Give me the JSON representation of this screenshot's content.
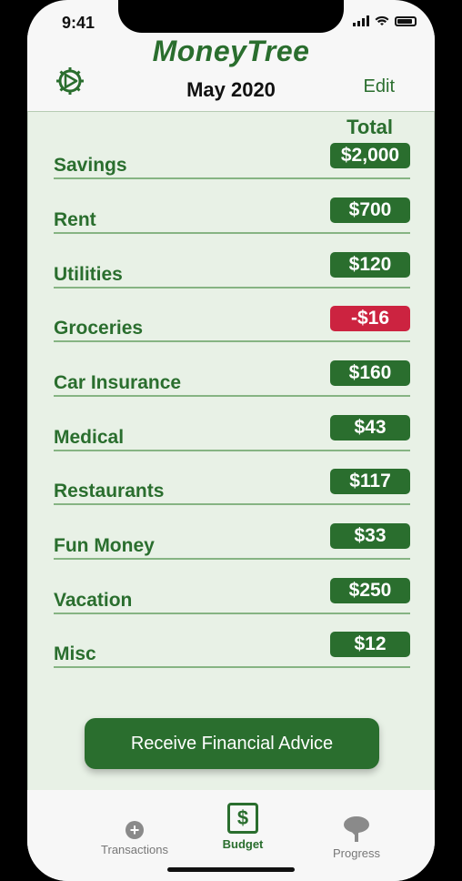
{
  "status": {
    "time": "9:41"
  },
  "header": {
    "app_title": "MoneyTree",
    "month": "May 2020",
    "edit_label": "Edit"
  },
  "table": {
    "total_header": "Total",
    "rows": [
      {
        "label": "Savings",
        "amount": "$2,000",
        "status": "positive"
      },
      {
        "label": "Rent",
        "amount": "$700",
        "status": "positive"
      },
      {
        "label": "Utilities",
        "amount": "$120",
        "status": "positive"
      },
      {
        "label": "Groceries",
        "amount": "-$16",
        "status": "negative"
      },
      {
        "label": "Car Insurance",
        "amount": "$160",
        "status": "positive"
      },
      {
        "label": "Medical",
        "amount": "$43",
        "status": "positive"
      },
      {
        "label": "Restaurants",
        "amount": "$117",
        "status": "positive"
      },
      {
        "label": "Fun Money",
        "amount": "$33",
        "status": "positive"
      },
      {
        "label": "Vacation",
        "amount": "$250",
        "status": "positive"
      },
      {
        "label": "Misc",
        "amount": "$12",
        "status": "positive"
      }
    ]
  },
  "advice_button": {
    "label": "Receive Financial  Advice"
  },
  "tabbar": {
    "tabs": [
      {
        "label": "Transactions",
        "icon": "plus-circle-icon",
        "active": false
      },
      {
        "label": "Budget",
        "icon": "dollar-box-icon",
        "active": true
      },
      {
        "label": "Progress",
        "icon": "tree-icon",
        "active": false
      }
    ]
  },
  "colors": {
    "brand_green": "#2a6e2e",
    "negative_red": "#cc2340",
    "content_bg": "#e8f1e6"
  }
}
